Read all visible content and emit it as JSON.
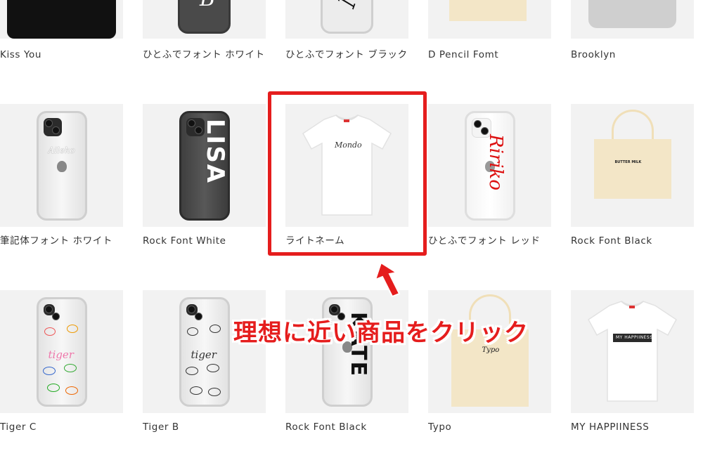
{
  "rows": [
    {
      "items": [
        {
          "name": "Kiss You"
        },
        {
          "name": "ひとふでフォント ホワイト"
        },
        {
          "name": "ひとふでフォント ブラック"
        },
        {
          "name": "D Pencil Fomt"
        },
        {
          "name": "Brooklyn"
        }
      ]
    },
    {
      "items": [
        {
          "name": "筆記体フォント ホワイト",
          "print": "Aileko"
        },
        {
          "name": "Rock Font White",
          "print": "LISA"
        },
        {
          "name": "ライトネーム",
          "print": "Mondo"
        },
        {
          "name": "ひとふでフォント レッド",
          "print": "Ririko"
        },
        {
          "name": "Rock Font Black",
          "print": "BUTTER MILK"
        }
      ]
    },
    {
      "items": [
        {
          "name": "Tiger C",
          "print": "tiger"
        },
        {
          "name": "Tiger B",
          "print": "tiger"
        },
        {
          "name": "Rock Font Black",
          "print": "KATE"
        },
        {
          "name": "Typo",
          "print": "Typo"
        },
        {
          "name": "MY HAPPIINESS",
          "print": "MY HAPPIINESS"
        }
      ]
    }
  ],
  "annotation": {
    "text": "理想に近い商品をクリック"
  },
  "colors": {
    "accent": "#e51d1d",
    "thumb_bg": "#f2f2f2"
  }
}
